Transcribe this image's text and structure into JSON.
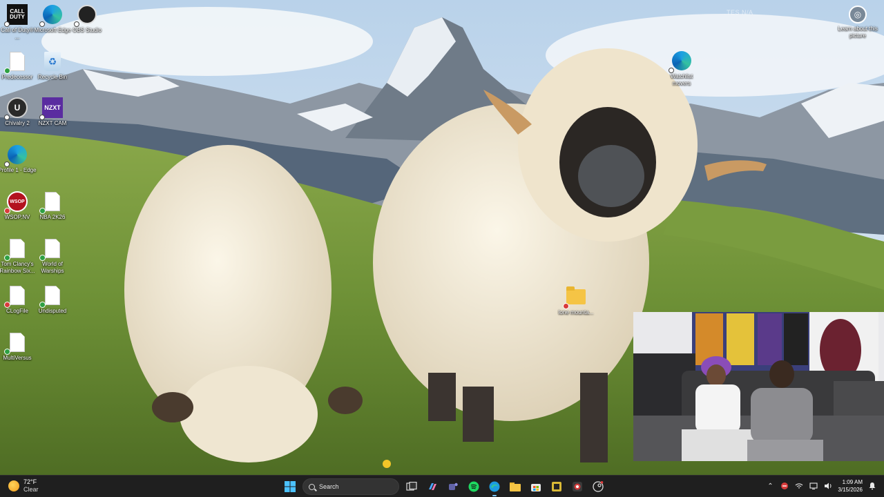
{
  "desktop": {
    "icons": [
      {
        "label": "Call of Duty® ...",
        "icon": "call-of-duty-icon",
        "badge": "shortcut"
      },
      {
        "label": "Microsoft Edge",
        "icon": "edge-icon",
        "badge": "shortcut"
      },
      {
        "label": "OBS Studio",
        "icon": "obs-icon",
        "badge": "shortcut"
      },
      {
        "label": "Predecessor",
        "icon": "document-icon",
        "badge": "ok"
      },
      {
        "label": "Recycle Bin",
        "icon": "recycle-bin-icon",
        "badge": "none"
      },
      {
        "label": "Chivalry 2",
        "icon": "unreal-icon",
        "badge": "shortcut"
      },
      {
        "label": "NZXT CAM",
        "icon": "nzxt-icon",
        "badge": "shortcut"
      },
      {
        "label": "Profile 1 - Edge",
        "icon": "edge-icon",
        "badge": "shortcut"
      },
      {
        "label": "WSOP.NV",
        "icon": "wsop-icon",
        "badge": "error"
      },
      {
        "label": "NBA 2K26",
        "icon": "document-icon",
        "badge": "ok"
      },
      {
        "label": "Tom Clancy's Rainbow Six...",
        "icon": "document-icon",
        "badge": "ok"
      },
      {
        "label": "World of Warships",
        "icon": "document-icon",
        "badge": "ok"
      },
      {
        "label": "CLogFile",
        "icon": "document-icon",
        "badge": "error"
      },
      {
        "label": "Undisputed",
        "icon": "document-icon",
        "badge": "ok"
      },
      {
        "label": "MultiVersus",
        "icon": "document-icon",
        "badge": "ok"
      },
      {
        "label": "Watchlist movers",
        "icon": "edge-icon",
        "badge": "shortcut"
      },
      {
        "label": "lone mounta...",
        "icon": "folder-icon",
        "badge": "error"
      }
    ],
    "learn_about": {
      "label": "Learn about this picture"
    },
    "faint_text": "TES N/A"
  },
  "taskbar": {
    "weather": {
      "temp": "72°F",
      "condition": "Clear"
    },
    "search_placeholder": "Search",
    "apps": [
      "start",
      "search",
      "task-view",
      "copilot",
      "teams",
      "spotify",
      "edge",
      "file-explorer",
      "store",
      "app-yellow",
      "app-red",
      "app-steam"
    ],
    "clock": {
      "time": "1:09 AM",
      "date": "3/15/2026"
    }
  },
  "colors": {
    "taskbar_bg": "#1f1f1f",
    "accent": "#7cc7ff"
  }
}
